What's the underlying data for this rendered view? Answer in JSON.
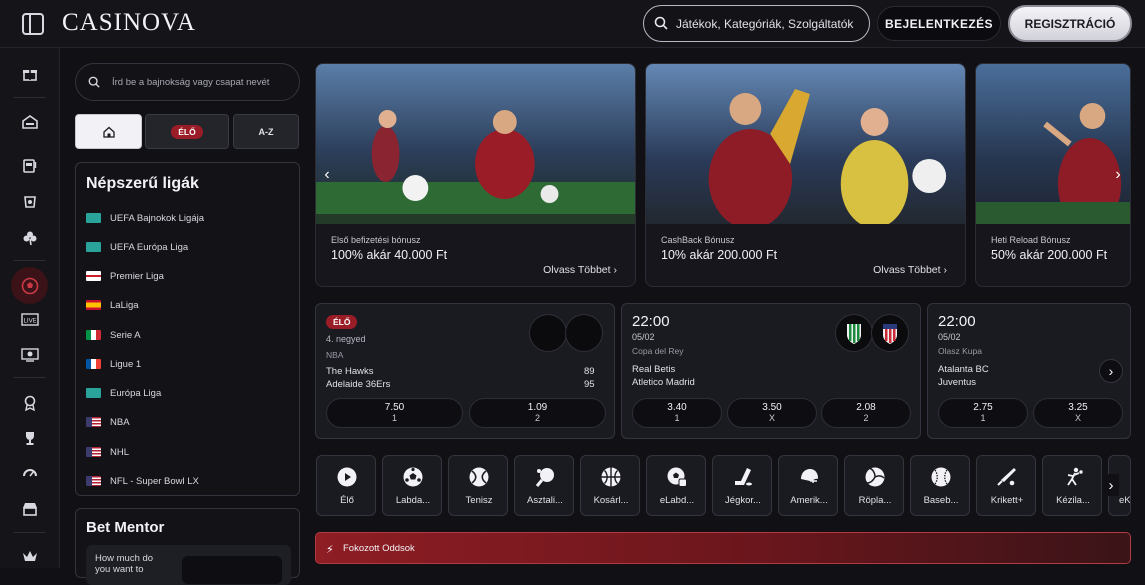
{
  "header": {
    "brand": "CASINOVA",
    "search_placeholder": "Játékok, Kategóriák, Szolgáltatók",
    "login_label": "BEJELENTKEZÉS",
    "register_label": "REGISZTRÁCIÓ"
  },
  "sidebar": {
    "search_placeholder": "Írd be a bajnokság vagy csapat nevét",
    "tabs": {
      "live": "ÉLŐ",
      "az": "A-Z"
    },
    "popular_title": "Népszerű ligák",
    "leagues": [
      {
        "name": "UEFA Bajnokok Ligája",
        "flag": "uefa"
      },
      {
        "name": "UEFA Európa Liga",
        "flag": "uefa"
      },
      {
        "name": "Premier Liga",
        "flag": "england"
      },
      {
        "name": "LaLiga",
        "flag": "spain"
      },
      {
        "name": "Serie A",
        "flag": "italy"
      },
      {
        "name": "Ligue 1",
        "flag": "france"
      },
      {
        "name": "Európa Liga",
        "flag": "uefa"
      },
      {
        "name": "NBA",
        "flag": "usa"
      },
      {
        "name": "NHL",
        "flag": "usa"
      },
      {
        "name": "NFL - Super Bowl LX",
        "flag": "usa"
      }
    ],
    "bet_mentor_title": "Bet Mentor",
    "bet_mentor_question": "How much do you want to"
  },
  "promos": [
    {
      "kicker": "Első befizetési bónusz",
      "headline": "100% akár 40.000 Ft",
      "more": "Olvass Többet"
    },
    {
      "kicker": "CashBack Bónusz",
      "headline": "10% akár 200.000 Ft",
      "more": "Olvass Többet"
    },
    {
      "kicker": "Heti Reload Bónusz",
      "headline": "50% akár 200.000 Ft",
      "more": ""
    }
  ],
  "matches": [
    {
      "live_badge": "ÉLŐ",
      "period": "4. negyed",
      "league": "NBA",
      "team1": "The Hawks",
      "team2": "Adelaide 36Ers",
      "score1": "89",
      "score2": "95",
      "odds": [
        {
          "value": "7.50",
          "label": "1"
        },
        {
          "value": "1.09",
          "label": "2"
        }
      ]
    },
    {
      "time": "22:00",
      "date": "05/02",
      "league": "Copa del Rey",
      "team1": "Real Betis",
      "team2": "Atletico Madrid",
      "odds": [
        {
          "value": "3.40",
          "label": "1"
        },
        {
          "value": "3.50",
          "label": "X"
        },
        {
          "value": "2.08",
          "label": "2"
        }
      ]
    },
    {
      "time": "22:00",
      "date": "05/02",
      "league": "Olasz Kupa",
      "team1": "Atalanta BC",
      "team2": "Juventus",
      "odds": [
        {
          "value": "2.75",
          "label": "1"
        },
        {
          "value": "3.25",
          "label": "X"
        }
      ]
    }
  ],
  "sports": [
    {
      "label": "Élő",
      "icon": "play-icon"
    },
    {
      "label": "Labda...",
      "icon": "soccer-ball-icon"
    },
    {
      "label": "Tenisz",
      "icon": "tennis-ball-icon"
    },
    {
      "label": "Asztali...",
      "icon": "table-tennis-icon"
    },
    {
      "label": "Kosárl...",
      "icon": "basketball-icon"
    },
    {
      "label": "eLabd...",
      "icon": "esoccer-icon"
    },
    {
      "label": "Jégkor...",
      "icon": "hockey-icon"
    },
    {
      "label": "Amerik...",
      "icon": "football-helmet-icon"
    },
    {
      "label": "Röpla...",
      "icon": "volleyball-icon"
    },
    {
      "label": "Baseb...",
      "icon": "baseball-icon"
    },
    {
      "label": "Krikett+",
      "icon": "cricket-icon"
    },
    {
      "label": "Kézila...",
      "icon": "handball-icon"
    },
    {
      "label": "eK",
      "icon": "esport-icon"
    }
  ],
  "boost": {
    "label": "Fokozott Oddsok"
  },
  "colors": {
    "accent": "#9a1c26",
    "background": "#101015",
    "card": "#1a1a21",
    "boost_bar": "#8e1d24"
  }
}
